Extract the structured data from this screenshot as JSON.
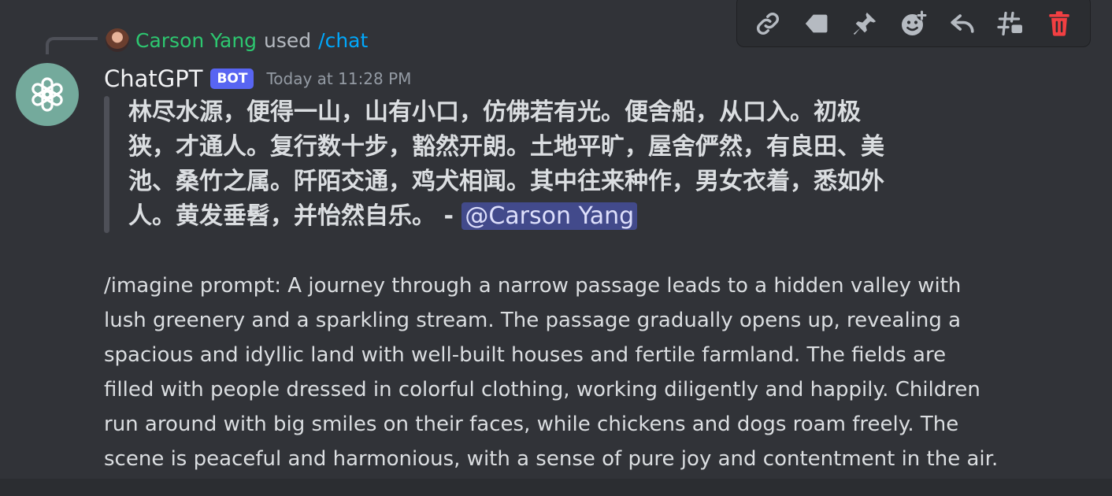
{
  "command": {
    "user": "Carson Yang",
    "used_text": "used",
    "command_name": "/chat"
  },
  "message": {
    "author": "ChatGPT",
    "badge": "BOT",
    "timestamp": "Today at 11:28 PM",
    "quote_lines": [
      "林尽水源，便得一山，山有小口，仿佛若有光。便舍船，从口入。初极",
      "狭，才通人。复行数十步，豁然开朗。土地平旷，屋舍俨然，有良田、美",
      "池、桑竹之属。阡陌交通，鸡犬相闻。其中往来种作，男女衣着，悉如外",
      "人。黄发垂髫，并怡然自乐。 - "
    ],
    "quote_mention": "@Carson Yang",
    "prompt_lines": [
      "/imagine prompt: A journey through a narrow passage leads to a hidden valley with",
      "lush greenery and a sparkling stream. The passage gradually opens up, revealing a",
      "spacious and idyllic land with well-built houses and fertile farmland. The fields are",
      "filled with people dressed in colorful clothing, working diligently and happily. Children",
      "run around with big smiles on their faces, while chickens and dogs roam freely. The",
      "scene is peaceful and harmonious, with a sense of pure joy and contentment in the air."
    ]
  },
  "toolbar": {
    "icons": [
      "link-icon",
      "tag-icon",
      "pin-icon",
      "add-reaction-icon",
      "reply-icon",
      "create-thread-icon",
      "delete-icon"
    ]
  },
  "colors": {
    "background": "#313338",
    "username_green": "#2dc770",
    "command_blue": "#00a8fc",
    "bot_badge": "#5865f2",
    "avatar_bg": "#74aa9c",
    "delete_red": "#f23f42",
    "icon_gray": "#b5bac1"
  }
}
